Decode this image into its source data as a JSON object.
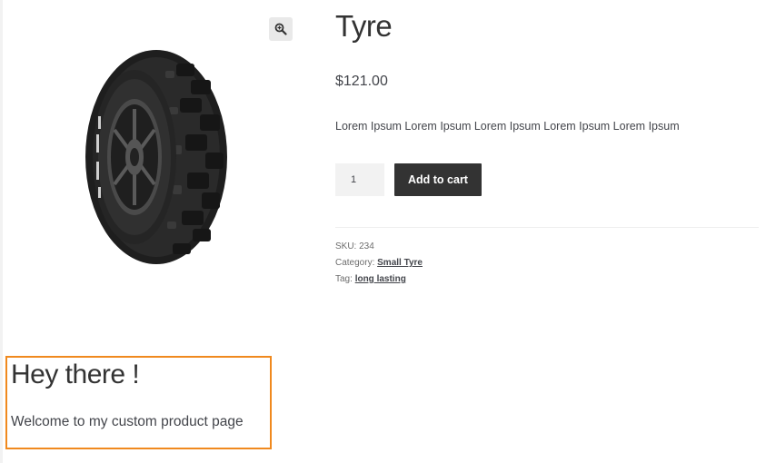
{
  "product": {
    "title": "Tyre",
    "price": "$121.00",
    "description": "Lorem Ipsum Lorem Ipsum Lorem Ipsum Lorem Ipsum Lorem Ipsum"
  },
  "cart": {
    "quantity_value": "1",
    "add_to_cart_label": "Add to cart"
  },
  "meta": {
    "sku_label": "SKU:",
    "sku_value": "234",
    "category_label": "Category:",
    "category_value": "Small Tyre",
    "tag_label": "Tag:",
    "tag_value": "long lasting"
  },
  "gallery": {
    "zoom_icon": "magnifier-zoom-icon",
    "image_icon": "tyre-image"
  },
  "welcome": {
    "title": "Hey there !",
    "text": "Welcome to my custom product page",
    "border_color": "#f0891e"
  },
  "colors": {
    "button_bg": "#333333",
    "text": "#43454b",
    "input_bg": "#f2f2f2"
  }
}
